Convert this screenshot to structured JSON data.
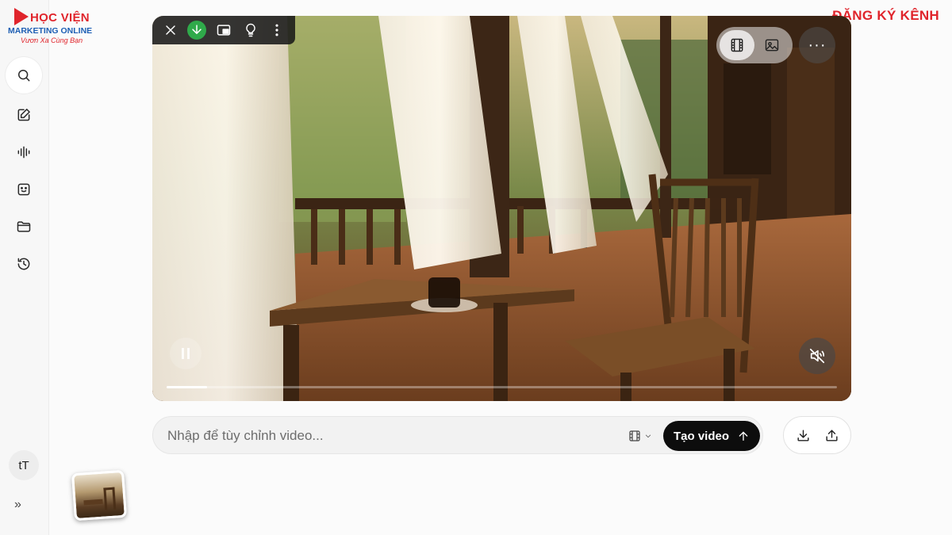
{
  "branding": {
    "logo_line1": "HỌC VIỆN",
    "logo_line2": "MARKETING ONLINE",
    "logo_line3": "Vươn Xa Cùng Bạn",
    "subscribe_label": "ĐĂNG KÝ KÊNH",
    "brand_red": "#e0242b",
    "brand_blue": "#1e5fb4"
  },
  "sidebar": {
    "items": [
      {
        "name": "search",
        "icon": "search-icon"
      },
      {
        "name": "new",
        "icon": "edit-icon"
      },
      {
        "name": "audio",
        "icon": "waveform-icon"
      },
      {
        "name": "assets",
        "icon": "sticker-icon"
      },
      {
        "name": "folder",
        "icon": "folder-icon"
      },
      {
        "name": "history",
        "icon": "history-icon"
      }
    ],
    "avatar_label": "tT",
    "expand_label": "»"
  },
  "video_toolbar": {
    "icons": [
      "close-icon",
      "download-icon",
      "picture-in-picture-icon",
      "lightbulb-icon",
      "more-vertical-icon"
    ]
  },
  "player": {
    "mode_options": [
      "video-icon",
      "image-icon"
    ],
    "active_mode": "video",
    "more_label": "···",
    "muted": true,
    "progress": 0.06
  },
  "prompt": {
    "placeholder": "Nhập để tùy chỉnh video...",
    "value": "",
    "create_label": "Tạo video"
  },
  "actions": {
    "icons": [
      "download-icon",
      "share-icon"
    ]
  }
}
